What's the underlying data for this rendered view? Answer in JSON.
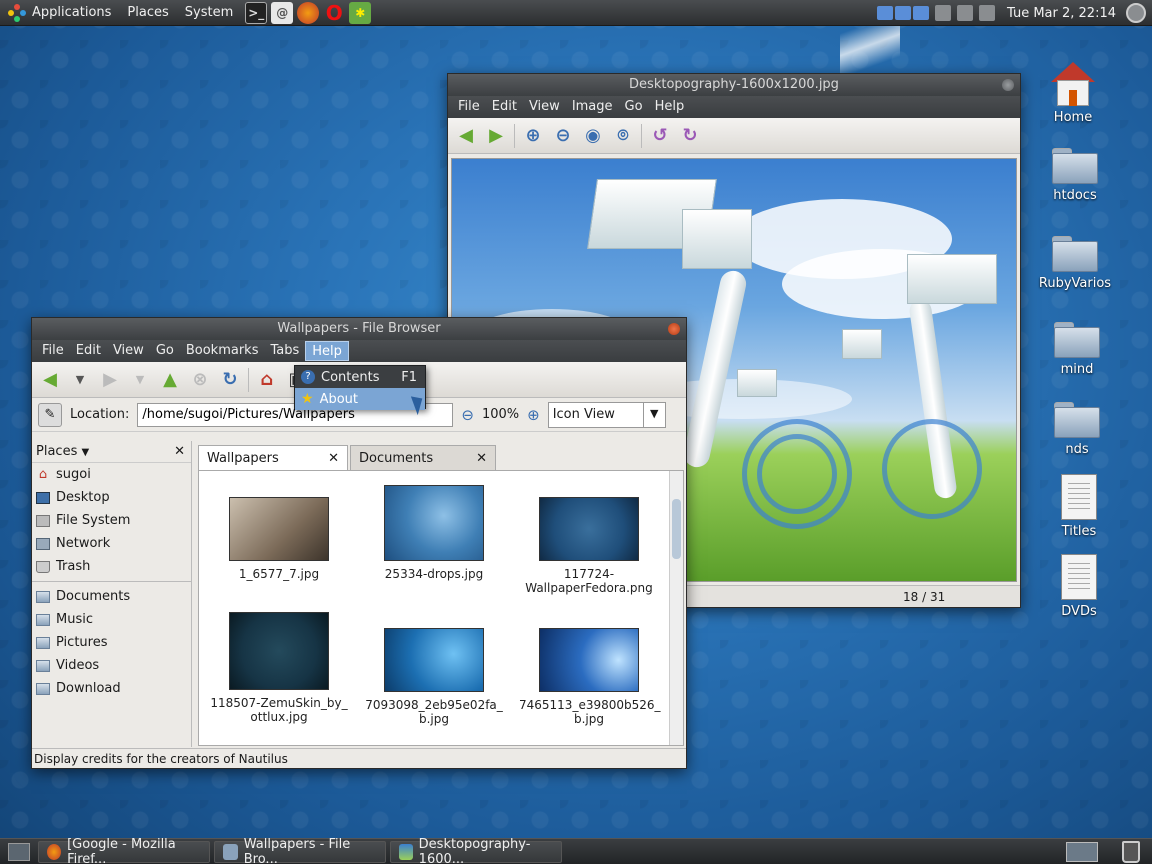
{
  "top_panel": {
    "menus": [
      "Applications",
      "Places",
      "System"
    ],
    "clock": "Tue Mar  2, 22:14"
  },
  "desktop_icons": [
    "Home",
    "htdocs",
    "RubyVarios",
    "mind",
    "nds",
    "Titles",
    "DVDs"
  ],
  "image_viewer": {
    "title": "Desktopography-1600x1200.jpg",
    "menu": [
      "File",
      "Edit",
      "View",
      "Image",
      "Go",
      "Help"
    ],
    "counter": "18 / 31"
  },
  "file_browser": {
    "title": "Wallpapers - File Browser",
    "menu": [
      "File",
      "Edit",
      "View",
      "Go",
      "Bookmarks",
      "Tabs",
      "Help"
    ],
    "location_label": "Location:",
    "location_value": "/home/sugoi/Pictures/Wallpapers",
    "zoom": "100%",
    "view_mode": "Icon View",
    "sidebar_title": "Places",
    "sidebar_items": [
      "sugoi",
      "Desktop",
      "File System",
      "Network",
      "Trash"
    ],
    "bookmark_items": [
      "Documents",
      "Music",
      "Pictures",
      "Videos",
      "Download"
    ],
    "tabs": [
      "Wallpapers",
      "Documents"
    ],
    "files": [
      {
        "name": "1_6577_7.jpg",
        "color": "#7b6a58"
      },
      {
        "name": "25334-drops.jpg",
        "color": "#3f7fb5"
      },
      {
        "name": "117724-\nWallpaperFedora.png",
        "color": "#1f4e7a"
      },
      {
        "name": "118507-ZemuSkin_by_\nottlux.jpg",
        "color": "#163445"
      },
      {
        "name": "7093098_2eb95e02fa_\nb.jpg",
        "color": "#1c6fb2"
      },
      {
        "name": "7465113_e39800b526_\nb.jpg",
        "color": "#2b6cc0"
      }
    ],
    "status": "Display credits for the creators of Nautilus"
  },
  "help_menu": {
    "items": [
      {
        "label": "Contents",
        "accel": "F1"
      },
      {
        "label": "About",
        "accel": ""
      }
    ]
  },
  "taskbar": [
    "[Google - Mozilla Firef...",
    "Wallpapers - File Bro...",
    "Desktopography-1600..."
  ]
}
